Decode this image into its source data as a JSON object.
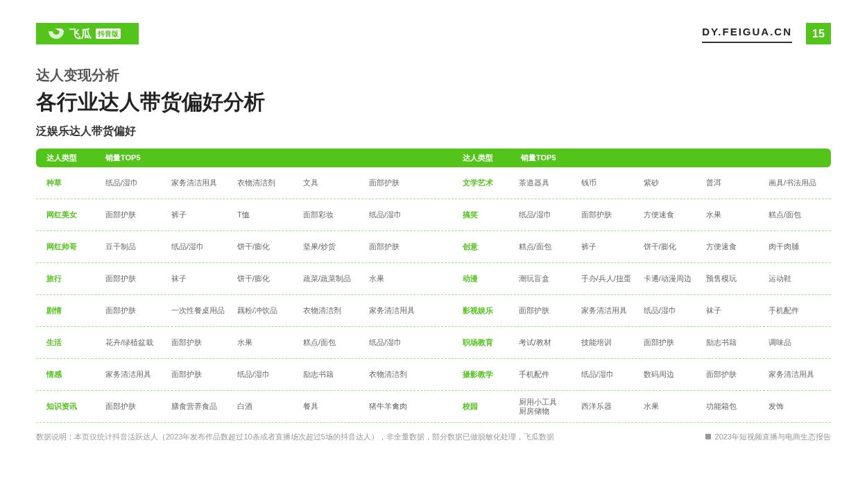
{
  "logo": {
    "name": "飞瓜",
    "badge": "抖音版"
  },
  "site": "DY.FEIGUA.CN",
  "page_number": "15",
  "section": "达人变现分析",
  "title": "各行业达人带货偏好分析",
  "subtitle": "泛娱乐达人带货偏好",
  "tables": [
    {
      "columns": [
        "达人类型",
        "销量TOP5"
      ],
      "rows": [
        {
          "type": "种草",
          "top5": [
            "纸品/湿巾",
            "家务清洁用具",
            "衣物清洁剂",
            "文具",
            "面部护肤"
          ]
        },
        {
          "type": "网红美女",
          "top5": [
            "面部护肤",
            "裤子",
            "T恤",
            "面部彩妆",
            "纸品/湿巾"
          ]
        },
        {
          "type": "网红帅哥",
          "top5": [
            "豆干制品",
            "纸品/湿巾",
            "饼干/膨化",
            "坚果/炒货",
            "面部护肤"
          ]
        },
        {
          "type": "旅行",
          "top5": [
            "面部护肤",
            "袜子",
            "饼干/膨化",
            "蔬菜/蔬菜制品",
            "水果"
          ]
        },
        {
          "type": "剧情",
          "top5": [
            "面部护肤",
            "一次性餐桌用品",
            "藕粉/冲饮品",
            "衣物清洁剂",
            "家务清洁用具"
          ]
        },
        {
          "type": "生活",
          "top5": [
            "花卉/绿植盆栽",
            "面部护肤",
            "水果",
            "糕点/面包",
            "纸品/湿巾"
          ]
        },
        {
          "type": "情感",
          "top5": [
            "家务清洁用具",
            "面部护肤",
            "纸品/湿巾",
            "励志书籍",
            "衣物清洁剂"
          ]
        },
        {
          "type": "知识资讯",
          "top5": [
            "面部护肤",
            "膳食营养食品",
            "白酒",
            "餐具",
            "猪牛羊禽肉"
          ]
        }
      ]
    },
    {
      "columns": [
        "达人类型",
        "销量TOP5"
      ],
      "rows": [
        {
          "type": "文学艺术",
          "top5": [
            "茶道器具",
            "钱币",
            "紫砂",
            "普洱",
            "画具/书法用品"
          ]
        },
        {
          "type": "搞笑",
          "top5": [
            "纸品/湿巾",
            "面部护肤",
            "方便速食",
            "水果",
            "糕点/面包"
          ]
        },
        {
          "type": "创意",
          "top5": [
            "糕点/面包",
            "裤子",
            "饼干/膨化",
            "方便速食",
            "肉干肉脯"
          ]
        },
        {
          "type": "动漫",
          "top5": [
            "潮玩盲盒",
            "手办/兵人/扭蛋",
            "卡通/动漫周边",
            "预售模玩",
            "运动鞋"
          ]
        },
        {
          "type": "影视娱乐",
          "top5": [
            "面部护肤",
            "家务清洁用具",
            "纸品/湿巾",
            "袜子",
            "手机配件"
          ]
        },
        {
          "type": "职场教育",
          "top5": [
            "考试/教材",
            "技能培训",
            "面部护肤",
            "励志书籍",
            "调味品"
          ]
        },
        {
          "type": "摄影教学",
          "top5": [
            "手机配件",
            "纸品/湿巾",
            "数码周边",
            "面部护肤",
            "家务清洁用具"
          ]
        },
        {
          "type": "校园",
          "top5": [
            [
              "厨用小工具",
              "厨房储物"
            ],
            "西洋乐器",
            "水果",
            "功能箱包",
            "发饰"
          ]
        }
      ]
    }
  ],
  "footnote": "数据说明：本页仅统计抖音活跃达人（2023年发布作品数超过10条或者直播场次超过5场的抖音达人），非全量数据，部分数据已做脱敏化处理，飞瓜数据",
  "report": "2023年短视频直播与电商生态报告"
}
